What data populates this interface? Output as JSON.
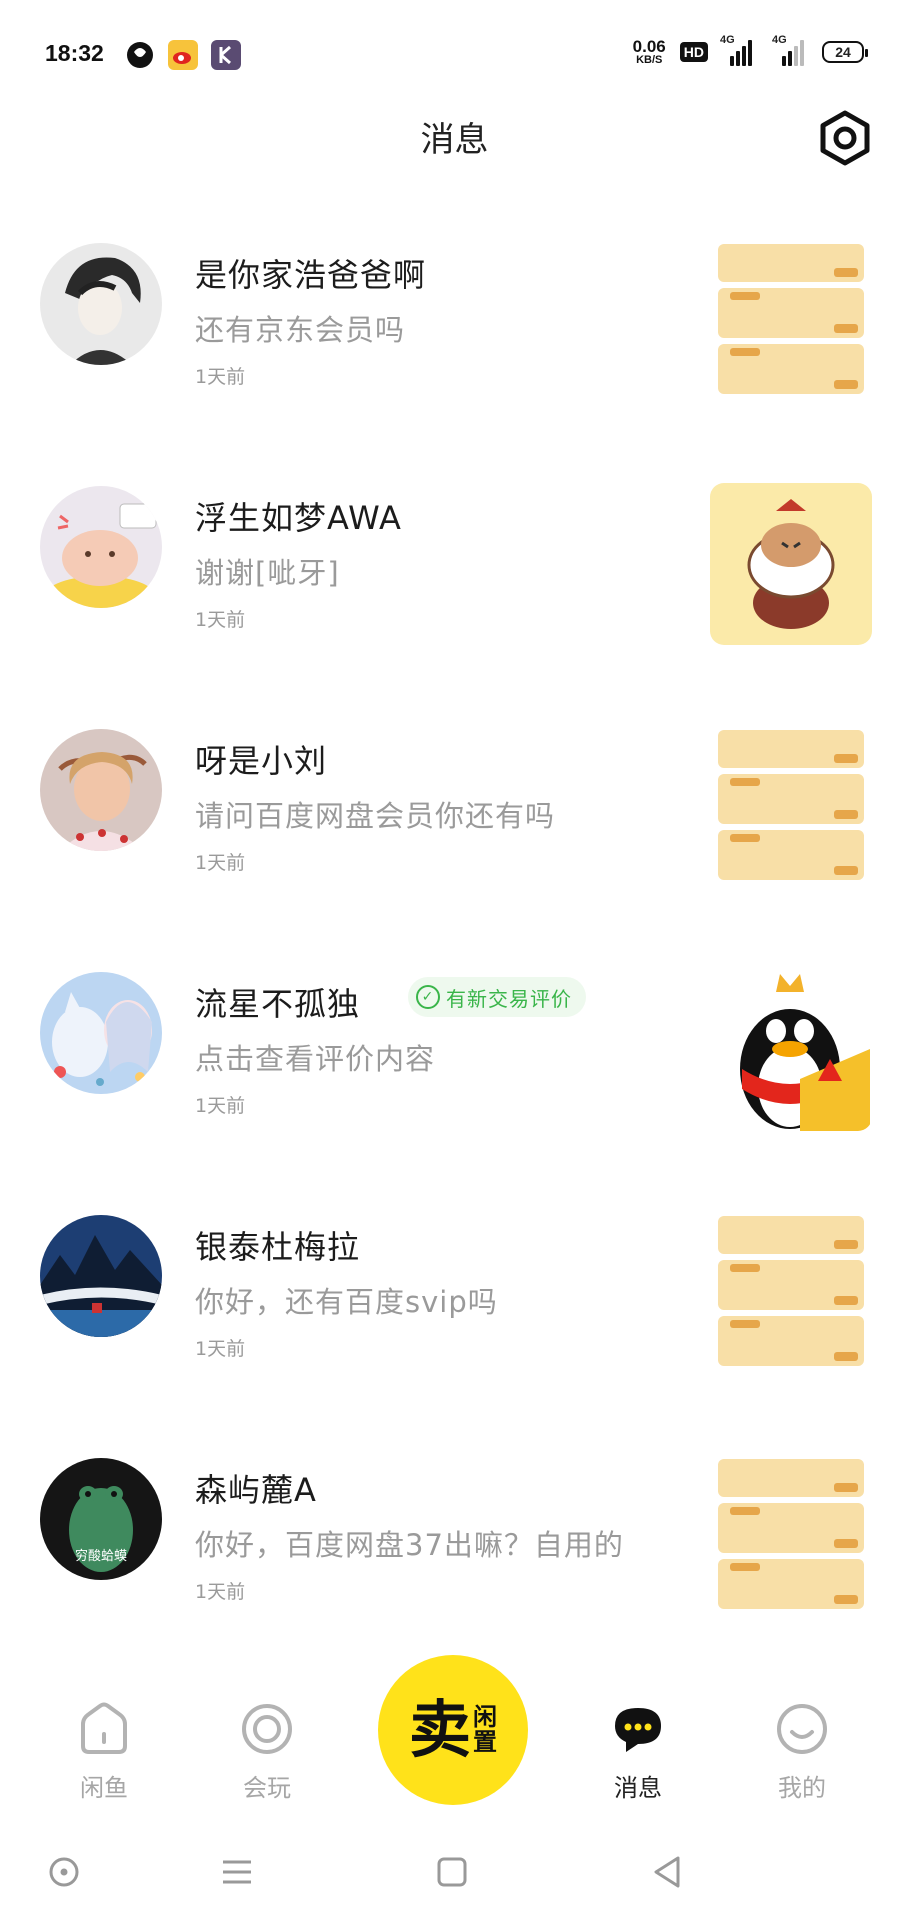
{
  "status_bar": {
    "time": "18:32",
    "speed_value": "0.06",
    "speed_unit": "KB/S",
    "hd_label": "HD",
    "signal1_label": "4G",
    "signal2_label": "4G",
    "battery": "24"
  },
  "header": {
    "title": "消息",
    "settings_icon": "settings-icon"
  },
  "messages": [
    {
      "name": "是你家浩爸爸啊",
      "preview": "还有京东会员吗",
      "time": "1天前",
      "avatar": "anime-boy-avatar",
      "thumb": "coupon-list-thumb"
    },
    {
      "name": "浮生如梦AWA",
      "preview": "谢谢[呲牙]",
      "time": "1天前",
      "avatar": "hamster-avatar",
      "thumb": "hamster-sticker-thumb"
    },
    {
      "name": "呀是小刘",
      "preview": "请问百度网盘会员你还有吗",
      "time": "1天前",
      "avatar": "girl-photo-avatar",
      "thumb": "coupon-list-thumb"
    },
    {
      "name": "流星不孤独",
      "preview": "点击查看评价内容",
      "time": "1天前",
      "avatar": "anime-girl-fox-avatar",
      "thumb": "penguin-urgent-sale-thumb",
      "badge": "有新交易评价"
    },
    {
      "name": "银泰杜梅拉",
      "preview": "你好，还有百度svip吗",
      "time": "1天前",
      "avatar": "landscape-painting-avatar",
      "thumb": "coupon-list-thumb"
    },
    {
      "name": "森屿麓A",
      "preview": "你好，百度网盘37出嘛？自用的",
      "time": "1天前",
      "avatar": "frog-avatar",
      "avatar_text": "穷酸蛤蟆",
      "thumb": "coupon-list-thumb"
    }
  ],
  "bottom_nav": {
    "items": [
      {
        "label": "闲鱼",
        "icon": "home-icon"
      },
      {
        "label": "会玩",
        "icon": "play-circle-icon"
      },
      {
        "label": "消息",
        "icon": "chat-bubble-icon",
        "active": true
      },
      {
        "label": "我的",
        "icon": "smile-profile-icon"
      }
    ],
    "sell_main": "卖",
    "sell_sub_1": "闲",
    "sell_sub_2": "置"
  },
  "system_nav": {
    "buttons": [
      "assistant-icon",
      "menu-icon",
      "home-square-icon",
      "back-icon"
    ]
  },
  "colors": {
    "accent_yellow": "#ffe21a",
    "review_green": "#3ab54a",
    "muted_text": "#9a9a9a"
  }
}
